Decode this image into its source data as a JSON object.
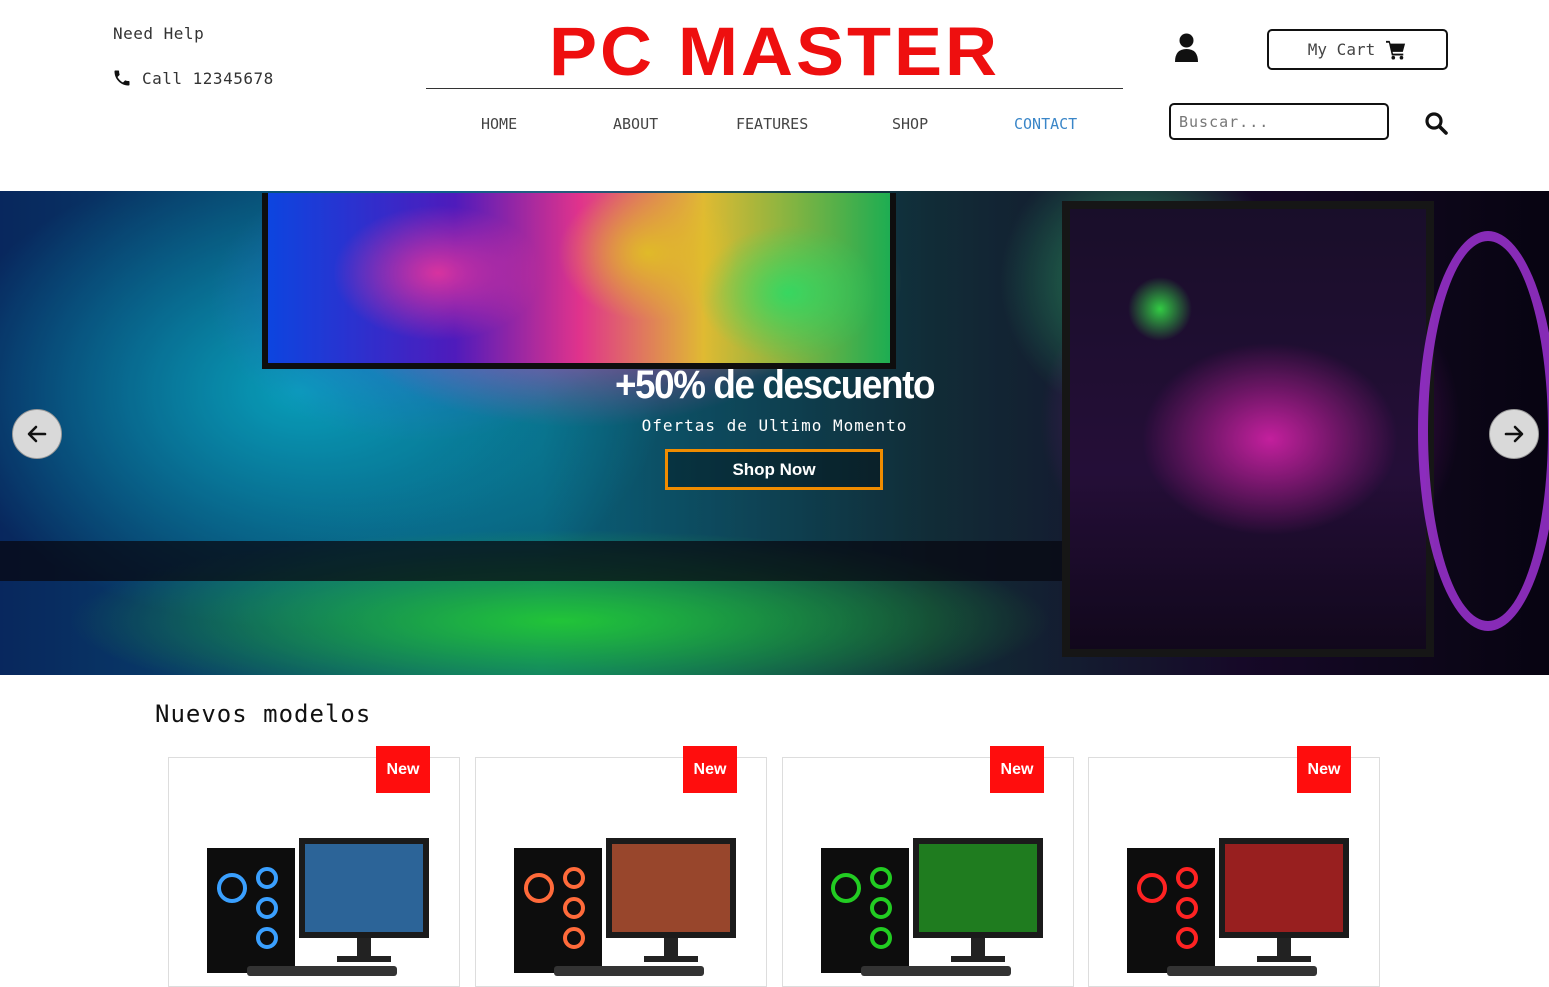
{
  "header": {
    "help_label": "Need Help",
    "phone_label": "Call 12345678",
    "brand": "PC MASTER",
    "cart_label": "My Cart",
    "search_placeholder": "Buscar..."
  },
  "nav": {
    "items": [
      "HOME",
      "ABOUT",
      "FEATURES",
      "SHOP",
      "CONTACT"
    ],
    "active": "CONTACT"
  },
  "hero": {
    "title": "+50% de descuento",
    "subtitle": "Ofertas de Ultimo Momento",
    "cta_label": "Shop Now"
  },
  "products": {
    "section_title": "Nuevos modelos",
    "badge_label": "New",
    "cards": [
      {
        "accent": "#3aa0ff"
      },
      {
        "accent": "#ff6a3a"
      },
      {
        "accent": "#22cc22"
      },
      {
        "accent": "#ff2222"
      }
    ]
  },
  "colors": {
    "brand_red": "#ee0f0f",
    "active_link": "#3a86c8",
    "cta_border": "#f08c00",
    "badge_red": "#ff0d0d"
  }
}
